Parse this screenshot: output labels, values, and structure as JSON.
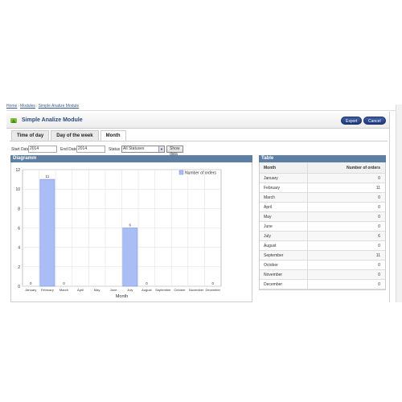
{
  "breadcrumb": [
    "Home",
    "Modules",
    "Simple Analize Module"
  ],
  "header": {
    "title": "Simple Analize Module",
    "export_label": "Export",
    "cancel_label": "Cancel"
  },
  "tabs": [
    {
      "label": "Time of day"
    },
    {
      "label": "Day of the week"
    },
    {
      "label": "Month"
    }
  ],
  "filters": {
    "start_label": "Start Date",
    "start_value": "2014",
    "end_label": "End Date",
    "end_value": "2014",
    "status_label": "Status",
    "status_value": "All Statuses",
    "show_label": "Show data"
  },
  "diagram": {
    "title": "Diagramm"
  },
  "table": {
    "title": "Table",
    "col_month": "Month",
    "col_orders": "Number of orders",
    "rows": [
      {
        "month": "January",
        "orders": "0"
      },
      {
        "month": "February",
        "orders": "11"
      },
      {
        "month": "March",
        "orders": "0"
      },
      {
        "month": "April",
        "orders": "0"
      },
      {
        "month": "May",
        "orders": "0"
      },
      {
        "month": "June",
        "orders": "0"
      },
      {
        "month": "July",
        "orders": "6"
      },
      {
        "month": "August",
        "orders": "0"
      },
      {
        "month": "September",
        "orders": "11"
      },
      {
        "month": "October",
        "orders": "0"
      },
      {
        "month": "November",
        "orders": "0"
      },
      {
        "month": "December",
        "orders": "0"
      }
    ]
  },
  "chart_data": {
    "type": "bar",
    "categories": [
      "January",
      "February",
      "March",
      "April",
      "May",
      "June",
      "July",
      "August",
      "September",
      "October",
      "November",
      "December"
    ],
    "series": [
      {
        "name": "Number of orders",
        "values": [
          0,
          11,
          0,
          0,
          0,
          0,
          6,
          0,
          0,
          0,
          0,
          0
        ],
        "color": "#aabdf5"
      }
    ],
    "data_labels": [
      "0",
      "11",
      "0",
      "",
      "",
      "",
      "6",
      "0",
      "",
      "",
      "",
      "0"
    ],
    "xlabel": "Month",
    "ylabel": "",
    "ylim": [
      0,
      12
    ],
    "yticks": [
      0,
      2,
      4,
      6,
      8,
      10,
      12
    ],
    "grid": true,
    "legend": "top-right"
  }
}
